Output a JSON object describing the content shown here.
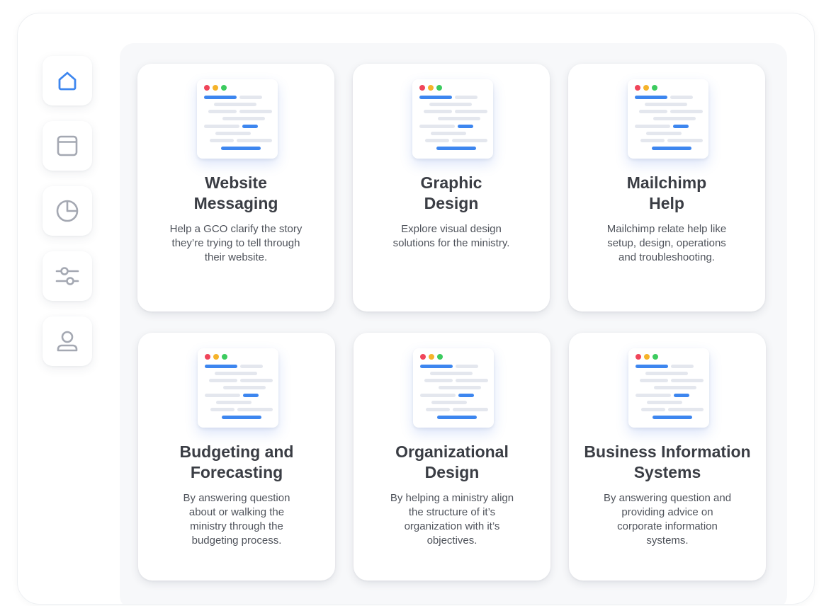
{
  "colors": {
    "accent": "#3d86ef",
    "icon_gray": "#a4a8b2",
    "title": "#3a3d44",
    "text": "#4f535b",
    "dot_red": "#f0455a",
    "dot_yellow": "#f5b32a",
    "dot_green": "#3ccb5f"
  },
  "sidebar": {
    "items": [
      {
        "icon": "home-icon",
        "active": true
      },
      {
        "icon": "window-icon",
        "active": false
      },
      {
        "icon": "pie-chart-icon",
        "active": false
      },
      {
        "icon": "sliders-icon",
        "active": false
      },
      {
        "icon": "user-icon",
        "active": false
      }
    ]
  },
  "cards": [
    {
      "title_line1": "Website",
      "title_line2": "Messaging",
      "desc_line1": "Help a GCO clarify the story",
      "desc_line2": "they’re trying to tell through",
      "desc_line3": "their website.",
      "desc_line4": ""
    },
    {
      "title_line1": "Graphic",
      "title_line2": "Design",
      "desc_line1": "Explore visual design",
      "desc_line2": "solutions for the ministry.",
      "desc_line3": "",
      "desc_line4": ""
    },
    {
      "title_line1": "Mailchimp",
      "title_line2": "Help",
      "desc_line1": "Mailchimp relate help like",
      "desc_line2": "setup, design, operations",
      "desc_line3": "and troubleshooting.",
      "desc_line4": ""
    },
    {
      "title_line1": "Budgeting and",
      "title_line2": "Forecasting",
      "desc_line1": "By answering question",
      "desc_line2": "about or walking the",
      "desc_line3": "ministry through the",
      "desc_line4": "budgeting process."
    },
    {
      "title_line1": "Organizational",
      "title_line2": "Design",
      "desc_line1": "By helping a ministry align",
      "desc_line2": "the structure of it’s",
      "desc_line3": "organization with it’s",
      "desc_line4": "objectives."
    },
    {
      "title_line1": "Business Information",
      "title_line2": "Systems",
      "desc_line1": "By answering question and",
      "desc_line2": "providing advice on",
      "desc_line3": "corporate information",
      "desc_line4": "systems."
    }
  ]
}
